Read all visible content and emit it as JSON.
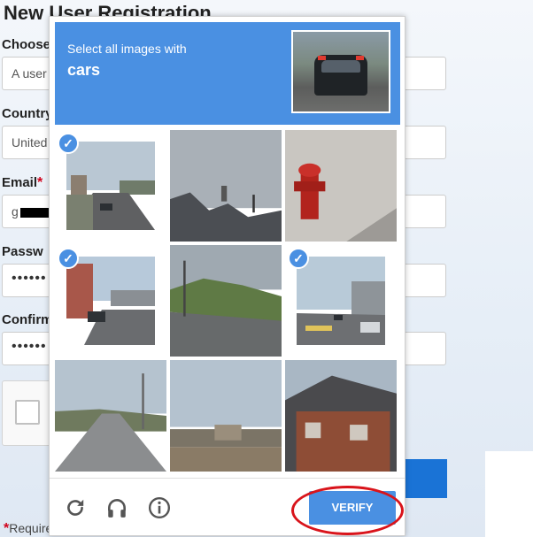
{
  "form": {
    "title": "New User Registration",
    "fields": [
      {
        "label": "Choose",
        "value": "A user"
      },
      {
        "label": "Country",
        "value": "United"
      },
      {
        "label": "Email",
        "value": "g"
      },
      {
        "label": "Passw",
        "value": "••••••"
      },
      {
        "label": "Confirm",
        "value": "••••••"
      }
    ],
    "required_star": "*",
    "required_note": "Required field"
  },
  "challenge": {
    "instruction_line1": "Select all images with",
    "instruction_line2": "cars",
    "check_glyph": "✓",
    "tiles": [
      {
        "name": "street-with-car",
        "selected": true
      },
      {
        "name": "rooftops",
        "selected": false
      },
      {
        "name": "fire-hydrant",
        "selected": false
      },
      {
        "name": "street-with-parked-car",
        "selected": true
      },
      {
        "name": "grassy-hill-road",
        "selected": false
      },
      {
        "name": "intersection-with-cars",
        "selected": true
      },
      {
        "name": "empty-highway",
        "selected": false
      },
      {
        "name": "construction-lot",
        "selected": false
      },
      {
        "name": "brick-house",
        "selected": false
      }
    ],
    "footer": {
      "reload_icon": "reload-icon",
      "audio_icon": "headphones-icon",
      "info_icon": "info-icon",
      "verify_label": "VERIFY"
    }
  },
  "colors": {
    "accent": "#4a90e2",
    "annotation": "#d9141b"
  }
}
